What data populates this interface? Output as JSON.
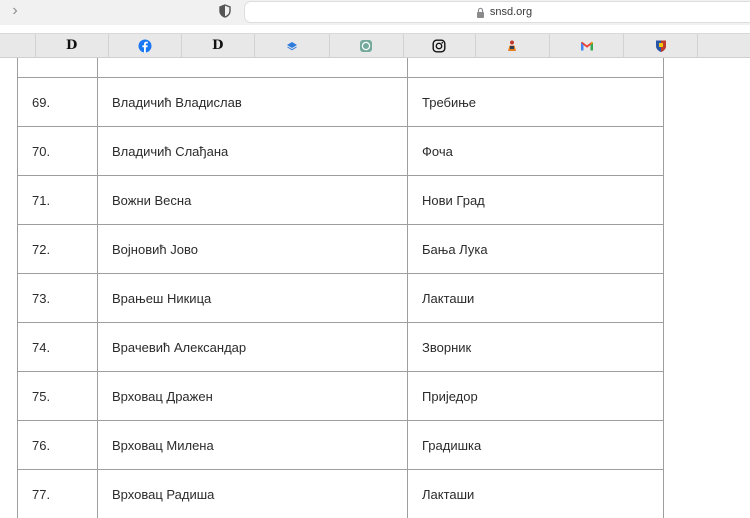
{
  "browser": {
    "address": "snsd.org",
    "forward_glyph": "›"
  },
  "favorites": [
    {
      "icon": "tab-edge-icon",
      "label": ""
    },
    {
      "icon": "d-letter-icon",
      "label": "D"
    },
    {
      "icon": "facebook-icon",
      "label": ""
    },
    {
      "icon": "d-letter-icon",
      "label": "D"
    },
    {
      "icon": "layers-icon",
      "label": ""
    },
    {
      "icon": "chat-bubble-icon",
      "label": ""
    },
    {
      "icon": "instagram-icon",
      "label": ""
    },
    {
      "icon": "person-icon",
      "label": ""
    },
    {
      "icon": "gmail-icon",
      "label": ""
    },
    {
      "icon": "shield-icon",
      "label": ""
    }
  ],
  "table": {
    "rows": [
      {
        "num": "",
        "name": "",
        "place": ""
      },
      {
        "num": "69.",
        "name": "Владичић Владислав",
        "place": "Требиње"
      },
      {
        "num": "70.",
        "name": "Владичић Слађана",
        "place": "Фоча"
      },
      {
        "num": "71.",
        "name": "Вожни Весна",
        "place": "Нови Град"
      },
      {
        "num": "72.",
        "name": "Војновић Јово",
        "place": "Бања Лука"
      },
      {
        "num": "73.",
        "name": "Врањеш Никица",
        "place": "Лакташи"
      },
      {
        "num": "74.",
        "name": "Врачевић Александар",
        "place": "Зворник"
      },
      {
        "num": "75.",
        "name": "Врховац Дражен",
        "place": "Приједор"
      },
      {
        "num": "76.",
        "name": "Врховац Милена",
        "place": "Градишка"
      },
      {
        "num": "77.",
        "name": "Врховац Радиша",
        "place": "Лакташи"
      }
    ]
  },
  "colors": {
    "facebook": "#1877f2",
    "gmail_red": "#ea4335",
    "border": "#9e9e9e"
  }
}
